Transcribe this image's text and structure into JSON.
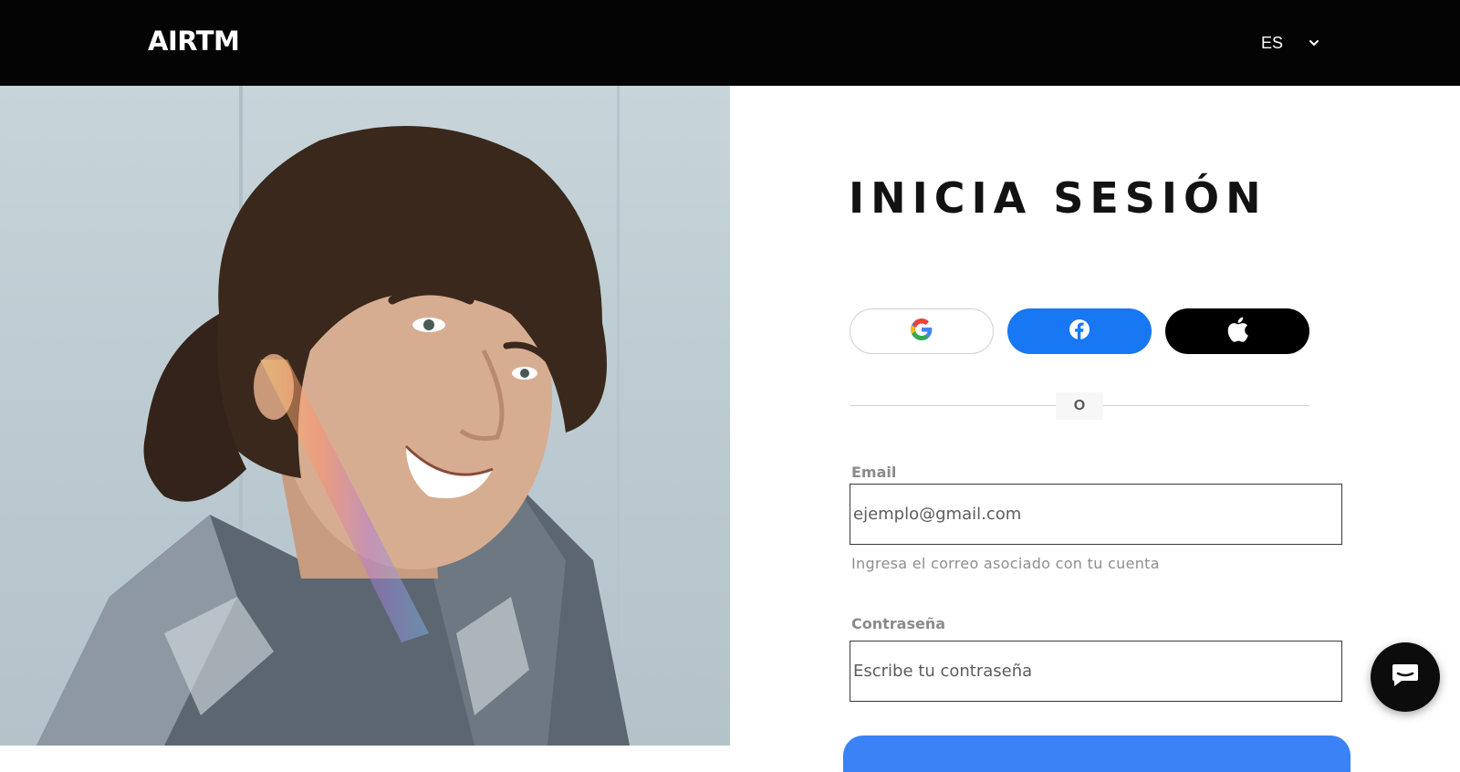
{
  "header": {
    "logo_text": "AIRTM",
    "language": {
      "selected": "ES",
      "icon": "chevron-down-icon"
    }
  },
  "hero": {
    "description_icon": "hero-photo"
  },
  "login": {
    "title": "INICIA SESIÓN",
    "social_buttons": [
      {
        "provider": "Google",
        "icon": "google-icon",
        "bg": "#ffffff"
      },
      {
        "provider": "Facebook",
        "icon": "facebook-icon",
        "bg": "#1877f2"
      },
      {
        "provider": "Apple",
        "icon": "apple-icon",
        "bg": "#000000"
      }
    ],
    "divider_text": "O",
    "email": {
      "label": "Email",
      "placeholder": "ejemplo@gmail.com",
      "hint": "Ingresa el correo asociado con tu cuenta"
    },
    "password": {
      "label": "Contraseña",
      "placeholder": "Escribe tu contraseña"
    }
  },
  "chat_widget": {
    "icon": "chat-icon"
  },
  "colors": {
    "header_bg": "#040404",
    "facebook": "#1877f2",
    "apple": "#000000",
    "primary_button": "#3b82f6"
  }
}
